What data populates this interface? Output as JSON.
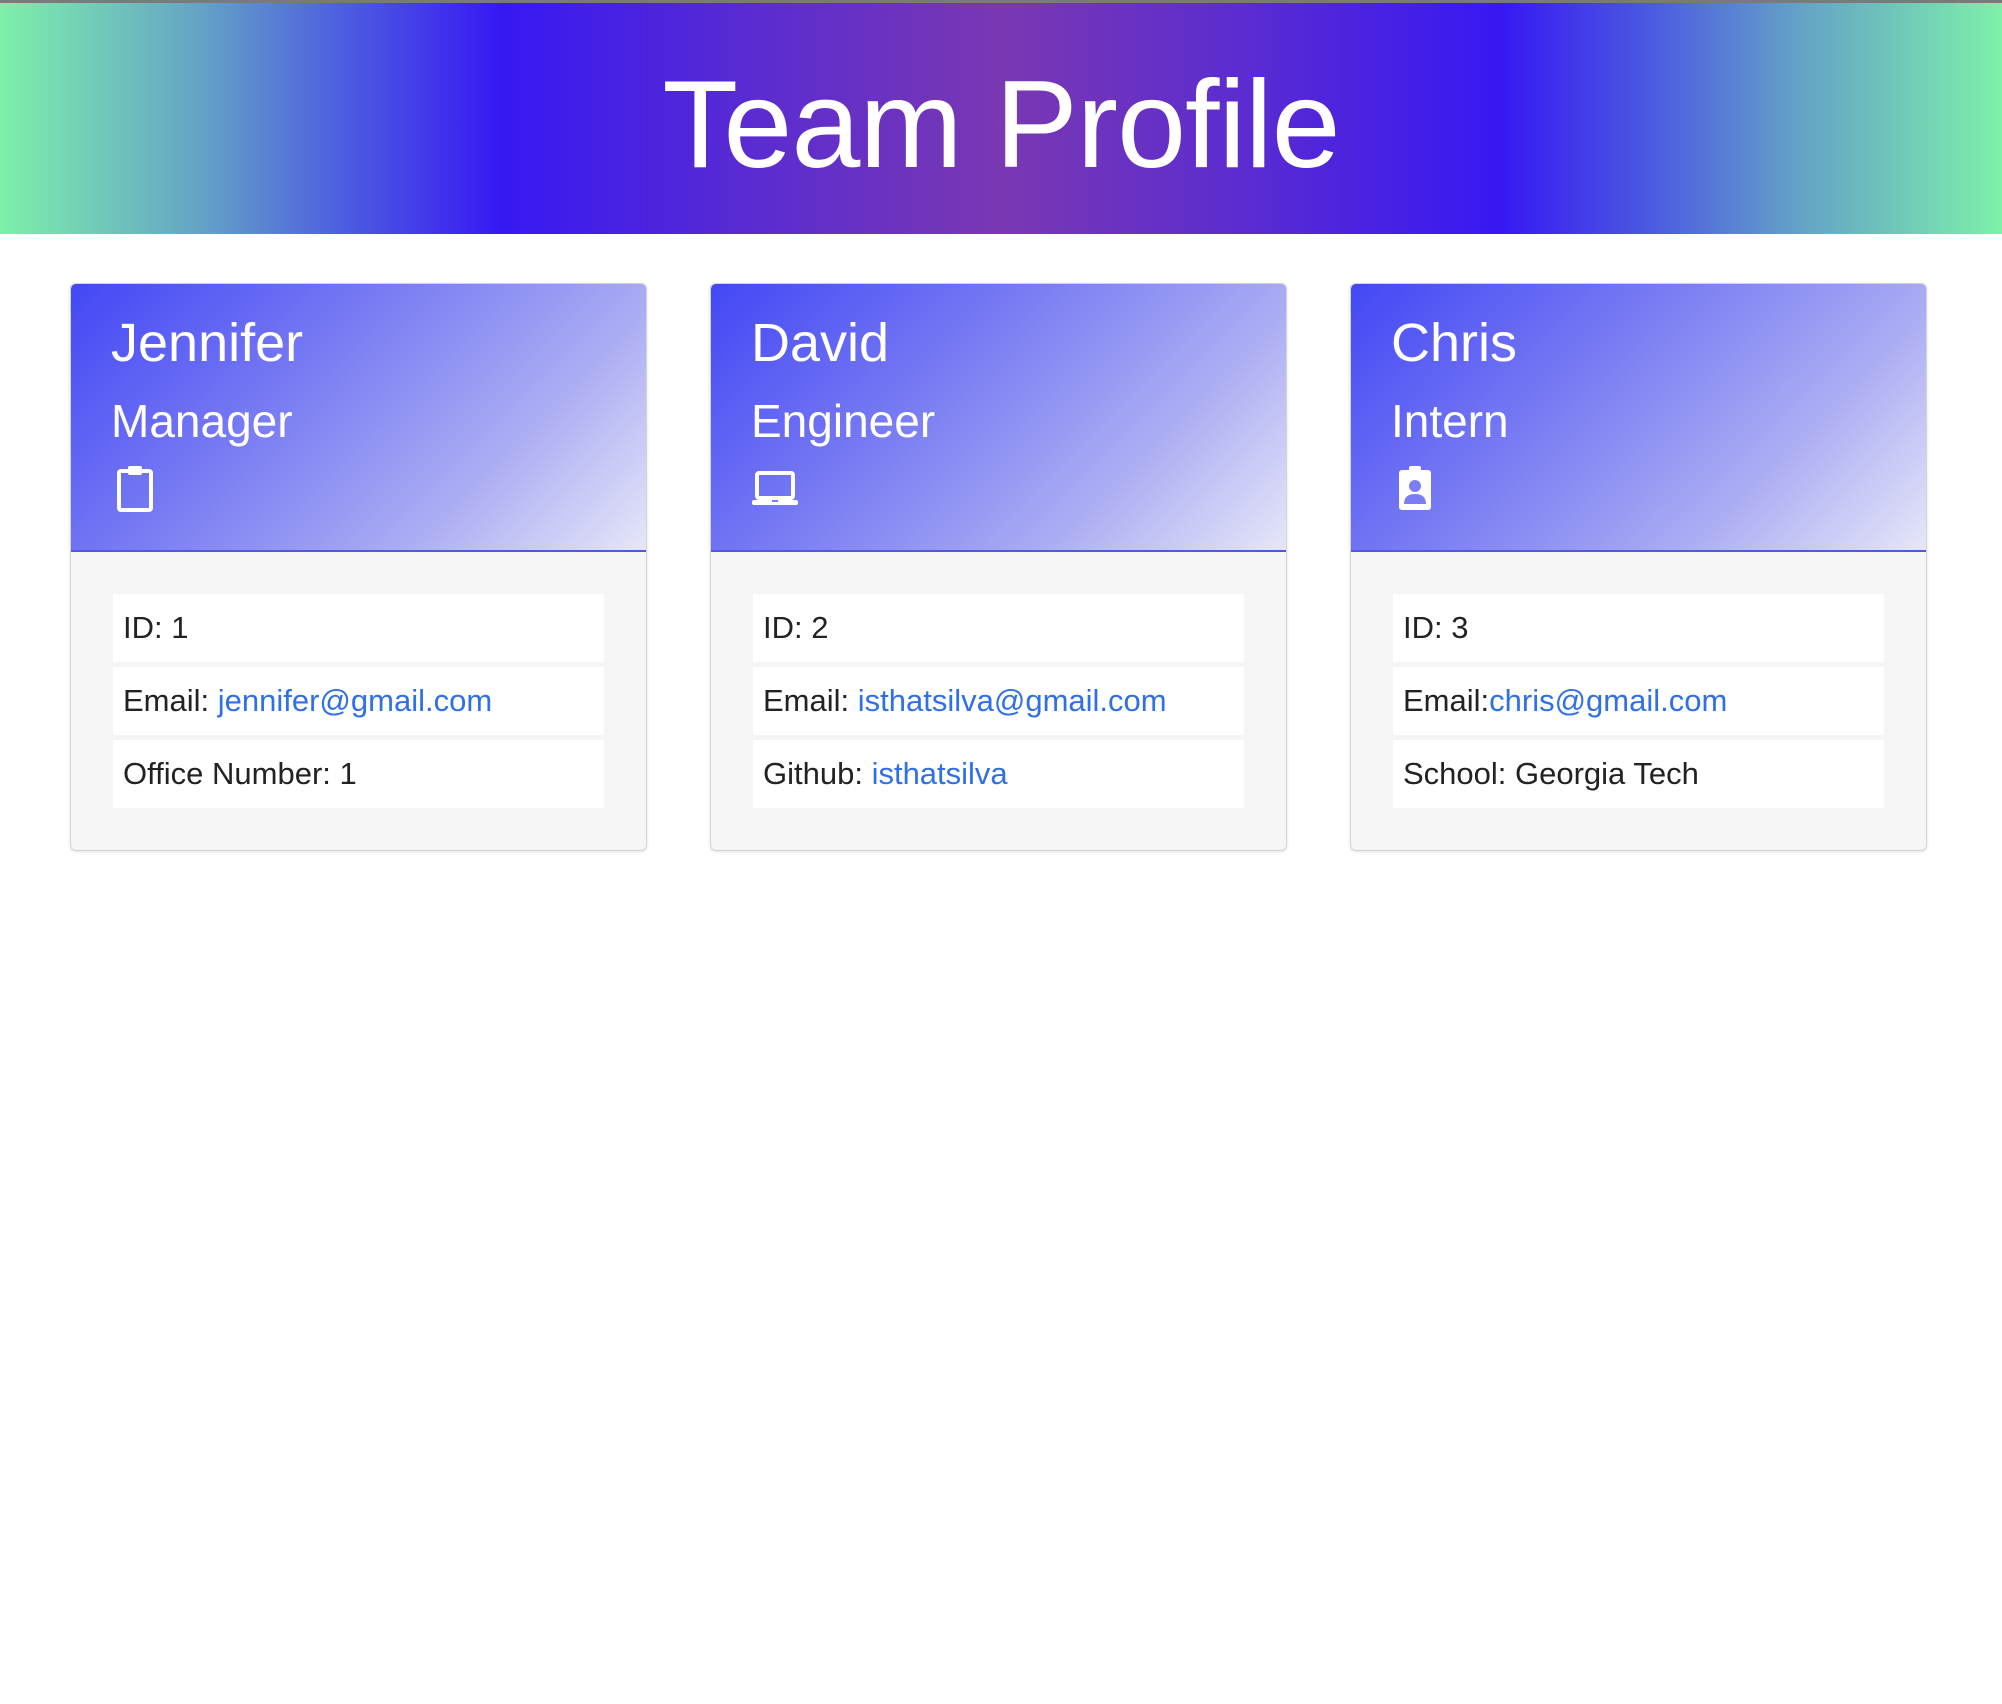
{
  "header": {
    "title": "Team Profile"
  },
  "cards": [
    {
      "name": "Jennifer",
      "role": "Manager",
      "icon": "clipboard-icon",
      "id_label": "ID: 1",
      "email_label": "Email: ",
      "email": "jennifer@gmail.com",
      "extra_label": "Office Number: 1",
      "extra_link": ""
    },
    {
      "name": "David",
      "role": "Engineer",
      "icon": "laptop-icon",
      "id_label": "ID: 2",
      "email_label": "Email: ",
      "email": "isthatsilva@gmail.com",
      "extra_label": "Github: ",
      "extra_link": "isthatsilva"
    },
    {
      "name": "Chris",
      "role": "Intern",
      "icon": "id-badge-icon",
      "id_label": "ID: 3",
      "email_label": "Email:",
      "email": "chris@gmail.com",
      "extra_label": "School: Georgia Tech",
      "extra_link": ""
    }
  ],
  "colors": {
    "link": "#2f6fe8",
    "card_header_start": "#4347f4",
    "hero_center": "#3718f3",
    "hero_edge": "#7df0aa"
  }
}
